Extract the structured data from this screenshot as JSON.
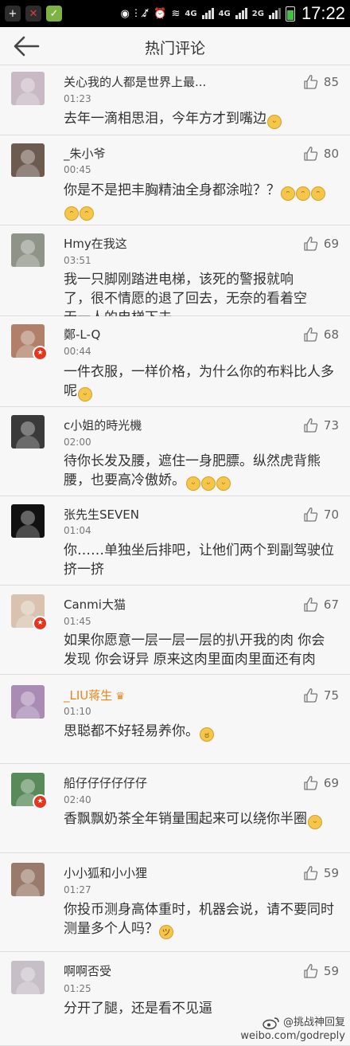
{
  "status_bar": {
    "network_labels": [
      "4G",
      "4G",
      "2G"
    ],
    "time": "17:22"
  },
  "header": {
    "title": "热门评论"
  },
  "comments": [
    {
      "username": "关心我的人都是世界上最...",
      "time": "01:23",
      "text": "去年一滴相思泪，今年方才到嘴边",
      "likes": "85",
      "avatar_color": "#c9b9c4",
      "emoji": [
        "smile"
      ]
    },
    {
      "username": "_朱小爷",
      "time": "00:45",
      "text": "你是不是把丰胸精油全身都涂啦？？",
      "likes": "80",
      "avatar_color": "#6d5b50",
      "emoji": [
        "blush",
        "blush",
        "blush",
        "blush",
        "blush"
      ]
    },
    {
      "username": "Hmy在我这",
      "time": "03:51",
      "text": "我一只脚刚踏进电梯，该死的警报就响了，很不情愿的退了回去，无奈的看着空无一人的电梯下去……",
      "likes": "69",
      "avatar_color": "#8f9488",
      "emoji": []
    },
    {
      "username": "鄭-L-Q",
      "time": "00:44",
      "text": "一件衣服，一样价格，为什么你的布料比人多呢",
      "likes": "68",
      "avatar_color": "#b0806a",
      "emoji": [
        "smile"
      ],
      "verified": true
    },
    {
      "username": "c小姐的時光機",
      "time": "02:00",
      "text": "待你长发及腰，遮住一身肥膘。纵然虎背熊腰，也要高冷傲娇。",
      "likes": "73",
      "avatar_color": "#3a3a3a",
      "emoji": [
        "wink",
        "wink",
        "wink"
      ]
    },
    {
      "username": "张先生SEVEN",
      "time": "01:04",
      "text": "你……单独坐后排吧，让他们两个到副驾驶位挤一挤",
      "likes": "70",
      "avatar_color": "#111111",
      "emoji": []
    },
    {
      "username": "Canmi大猫",
      "time": "01:45",
      "text": "如果你愿意一层一层一层的扒开我的肉 你会发现 你会讶异 原来这肉里面肉里面还有肉",
      "likes": "67",
      "avatar_color": "#d9c3b0",
      "emoji": [],
      "verified": true
    },
    {
      "username": "_LIU蒋生",
      "time": "01:10",
      "text": "思聪都不好轻易养你。",
      "likes": "75",
      "avatar_color": "#a98bb4",
      "emoji": [
        "angry"
      ],
      "orange_name": true
    },
    {
      "username": "船仔仔仔仔仔仔",
      "time": "02:40",
      "text": "香飘飘奶茶全年销量围起来可以绕你半圈",
      "likes": "69",
      "avatar_color": "#5a8a5a",
      "emoji": [
        "smile"
      ],
      "verified": true
    },
    {
      "username": "小小狐和小小狸",
      "time": "01:27",
      "text": "你投币测身高体重时，机器会说，请不要同时测量多个人吗？",
      "likes": "59",
      "avatar_color": "#9a7a6a",
      "emoji": [
        "grin"
      ]
    },
    {
      "username": "啊啊否受",
      "time": "01:25",
      "text": "分开了腿，还是看不见逼",
      "likes": "59",
      "avatar_color": "#c7bfc7",
      "emoji": []
    }
  ],
  "watermark": {
    "handle": "@挑战神回复",
    "site": "weibo.com/godreply"
  }
}
